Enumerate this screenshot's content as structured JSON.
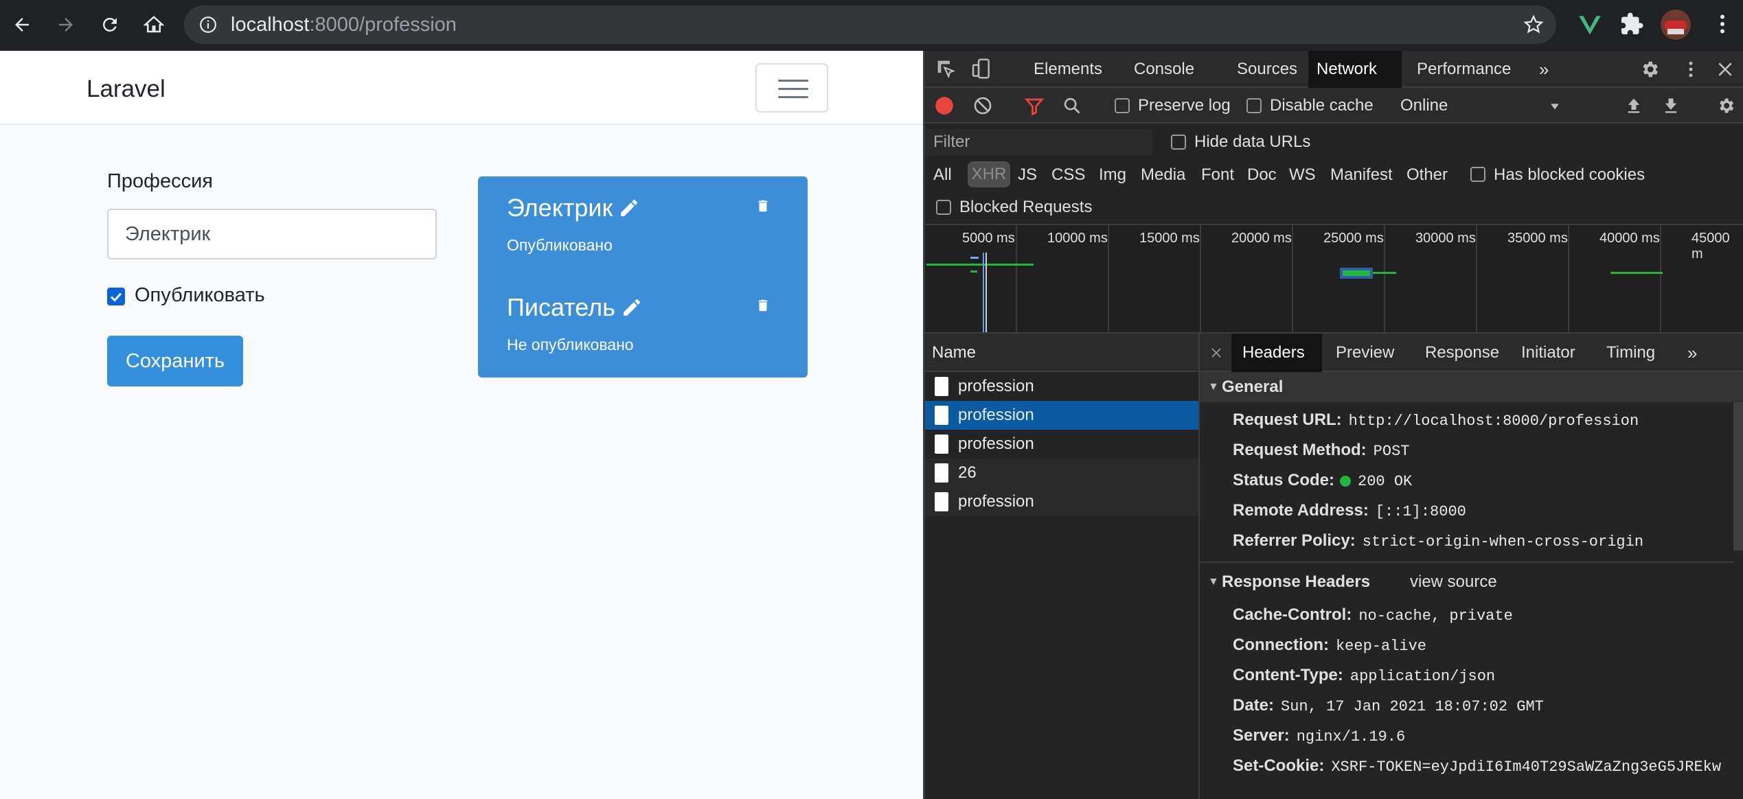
{
  "browser": {
    "url_host": "localhost",
    "url_rest": ":8000/profession"
  },
  "page": {
    "brand": "Laravel",
    "form": {
      "label": "Профессия",
      "input_value": "Электрик",
      "checkbox_label": "Опубликовать",
      "checkbox_checked": true,
      "save_label": "Сохранить"
    },
    "cards": [
      {
        "title": "Электрик",
        "status": "Опубликовано"
      },
      {
        "title": "Писатель",
        "status": "Не опубликовано"
      }
    ]
  },
  "devtools": {
    "tabs": [
      "Elements",
      "Console",
      "Sources",
      "Network",
      "Performance"
    ],
    "active_tab": "Network",
    "toolbar": {
      "preserve_log": "Preserve log",
      "disable_cache": "Disable cache",
      "throttle": "Online"
    },
    "filter": {
      "placeholder": "Filter",
      "hide_data_urls": "Hide data URLs",
      "types": [
        "All",
        "XHR",
        "JS",
        "CSS",
        "Img",
        "Media",
        "Font",
        "Doc",
        "WS",
        "Manifest",
        "Other"
      ],
      "active_type": "XHR",
      "has_blocked_cookies": "Has blocked cookies",
      "blocked_requests": "Blocked Requests"
    },
    "timeline_ticks": [
      "5000 ms",
      "10000 ms",
      "15000 ms",
      "20000 ms",
      "25000 ms",
      "30000 ms",
      "35000 ms",
      "40000 ms",
      "45000 m"
    ],
    "name_header": "Name",
    "requests": [
      "profession",
      "profession",
      "profession",
      "26",
      "profession"
    ],
    "selected_request": 1,
    "detail_tabs": [
      "Headers",
      "Preview",
      "Response",
      "Initiator",
      "Timing"
    ],
    "active_detail_tab": "Headers",
    "general": {
      "title": "General",
      "rows": [
        {
          "key": "Request URL:",
          "value": "http://localhost:8000/profession"
        },
        {
          "key": "Request Method:",
          "value": "POST"
        },
        {
          "key": "Status Code:",
          "value": "200 OK"
        },
        {
          "key": "Remote Address:",
          "value": "[::1]:8000"
        },
        {
          "key": "Referrer Policy:",
          "value": "strict-origin-when-cross-origin"
        }
      ]
    },
    "response_headers": {
      "title": "Response Headers",
      "view_source": "view source",
      "rows": [
        {
          "key": "Cache-Control:",
          "value": "no-cache, private"
        },
        {
          "key": "Connection:",
          "value": "keep-alive"
        },
        {
          "key": "Content-Type:",
          "value": "application/json"
        },
        {
          "key": "Date:",
          "value": "Sun, 17 Jan 2021 18:07:02 GMT"
        },
        {
          "key": "Server:",
          "value": "nginx/1.19.6"
        },
        {
          "key": "Set-Cookie:",
          "value": "XSRF-TOKEN=eyJpdiI6Im40T29SaWZaZng3eG5JREkw"
        }
      ]
    }
  },
  "colors": {
    "primary": "#3490dc",
    "card": "#3c8ed8",
    "devtools_bg": "#242424",
    "selected_row": "#0b5ba3",
    "record": "#e8453c"
  }
}
